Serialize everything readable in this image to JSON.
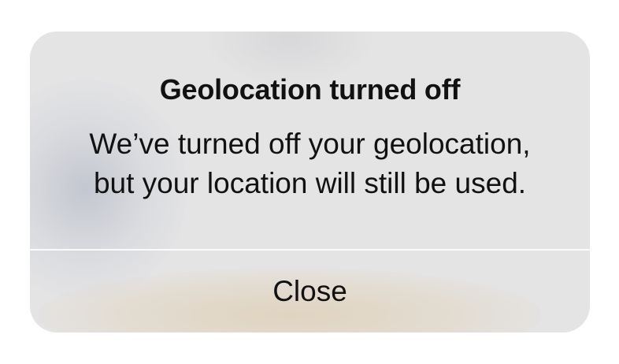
{
  "alert": {
    "title": "Geolocation turned off",
    "message_lines": [
      "We’ve turned off your geolocation,",
      "but your location will still be used."
    ],
    "close_label": "Close"
  }
}
